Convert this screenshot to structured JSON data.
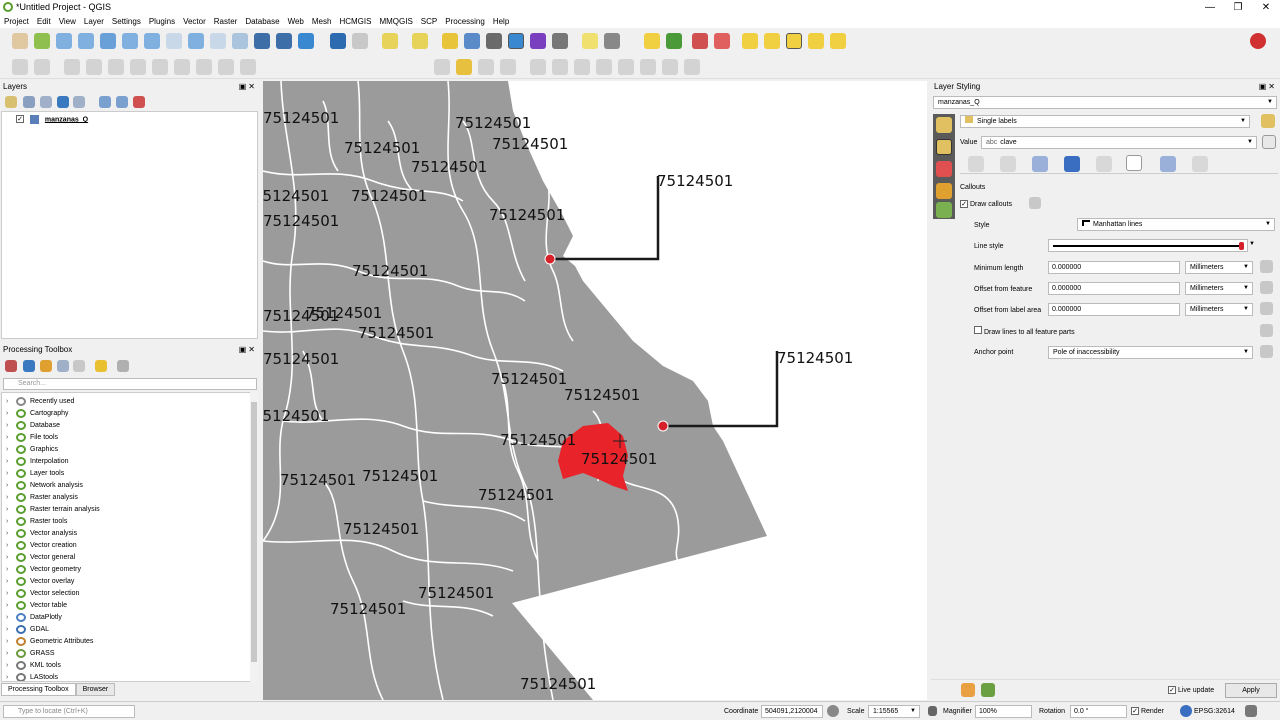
{
  "window": {
    "title": "*Untitled Project - QGIS",
    "controls": [
      "—",
      "❐",
      "✕"
    ]
  },
  "menu": [
    "Project",
    "Edit",
    "View",
    "Layer",
    "Settings",
    "Plugins",
    "Vector",
    "Raster",
    "Database",
    "Web",
    "Mesh",
    "HCMGIS",
    "MMQGIS",
    "SCP",
    "Processing",
    "Help"
  ],
  "layers_panel": {
    "title": "Layers",
    "layer_name": "manzanas_Q",
    "layer_checked": true
  },
  "processing_panel": {
    "title": "Processing Toolbox",
    "search_placeholder": "Search...",
    "items": [
      {
        "label": "Recently used",
        "color": "#888888"
      },
      {
        "label": "Cartography",
        "color": "#5a9e2f"
      },
      {
        "label": "Database",
        "color": "#5a9e2f"
      },
      {
        "label": "File tools",
        "color": "#5a9e2f"
      },
      {
        "label": "Graphics",
        "color": "#5a9e2f"
      },
      {
        "label": "Interpolation",
        "color": "#5a9e2f"
      },
      {
        "label": "Layer tools",
        "color": "#5a9e2f"
      },
      {
        "label": "Network analysis",
        "color": "#5a9e2f"
      },
      {
        "label": "Raster analysis",
        "color": "#5a9e2f"
      },
      {
        "label": "Raster terrain analysis",
        "color": "#5a9e2f"
      },
      {
        "label": "Raster tools",
        "color": "#5a9e2f"
      },
      {
        "label": "Vector analysis",
        "color": "#5a9e2f"
      },
      {
        "label": "Vector creation",
        "color": "#5a9e2f"
      },
      {
        "label": "Vector general",
        "color": "#5a9e2f"
      },
      {
        "label": "Vector geometry",
        "color": "#5a9e2f"
      },
      {
        "label": "Vector overlay",
        "color": "#5a9e2f"
      },
      {
        "label": "Vector selection",
        "color": "#5a9e2f"
      },
      {
        "label": "Vector table",
        "color": "#5a9e2f"
      },
      {
        "label": "DataPlotly",
        "color": "#4a7fc0"
      },
      {
        "label": "GDAL",
        "color": "#3a6db0"
      },
      {
        "label": "Geometric Attributes",
        "color": "#c08030"
      },
      {
        "label": "GRASS",
        "color": "#6a9a3a"
      },
      {
        "label": "KML tools",
        "color": "#777777"
      },
      {
        "label": "LAStools",
        "color": "#777777"
      }
    ],
    "tabs": [
      "Processing Toolbox",
      "Browser"
    ]
  },
  "map": {
    "label_text": "75124501",
    "polygon_fill": "#9b9b9b",
    "selected_fill": "#e8232a",
    "callout_color": "#1a1a1a",
    "anchor_color": "#d6202a"
  },
  "styling_panel": {
    "title": "Layer Styling",
    "layer": "manzanas_Q",
    "renderer": "Single labels",
    "value_label": "Value",
    "value": "clave",
    "section": "Callouts",
    "draw_callouts_label": "Draw callouts",
    "draw_callouts": true,
    "style_label": "Style",
    "style_value": "Manhattan lines",
    "line_style_label": "Line style",
    "min_length_label": "Minimum length",
    "min_length": "0.000000",
    "offset_feature_label": "Offset from feature",
    "offset_feature": "0.000000",
    "offset_label_area_label": "Offset from label area",
    "offset_label_area": "0.000000",
    "unit": "Millimeters",
    "draw_all_parts_label": "Draw lines to all feature parts",
    "anchor_label": "Anchor point",
    "anchor_value": "Pole of inaccessibility",
    "live_update_label": "Live update",
    "apply_label": "Apply"
  },
  "status": {
    "locate_placeholder": "Type to locate (Ctrl+K)",
    "coordinate_label": "Coordinate",
    "coordinate": "504091,2120004",
    "scale_label": "Scale",
    "scale": "1:15565",
    "magnifier_label": "Magnifier",
    "magnifier": "100%",
    "rotation_label": "Rotation",
    "rotation": "0.0 °",
    "render_label": "Render",
    "crs": "EPSG:32614"
  }
}
